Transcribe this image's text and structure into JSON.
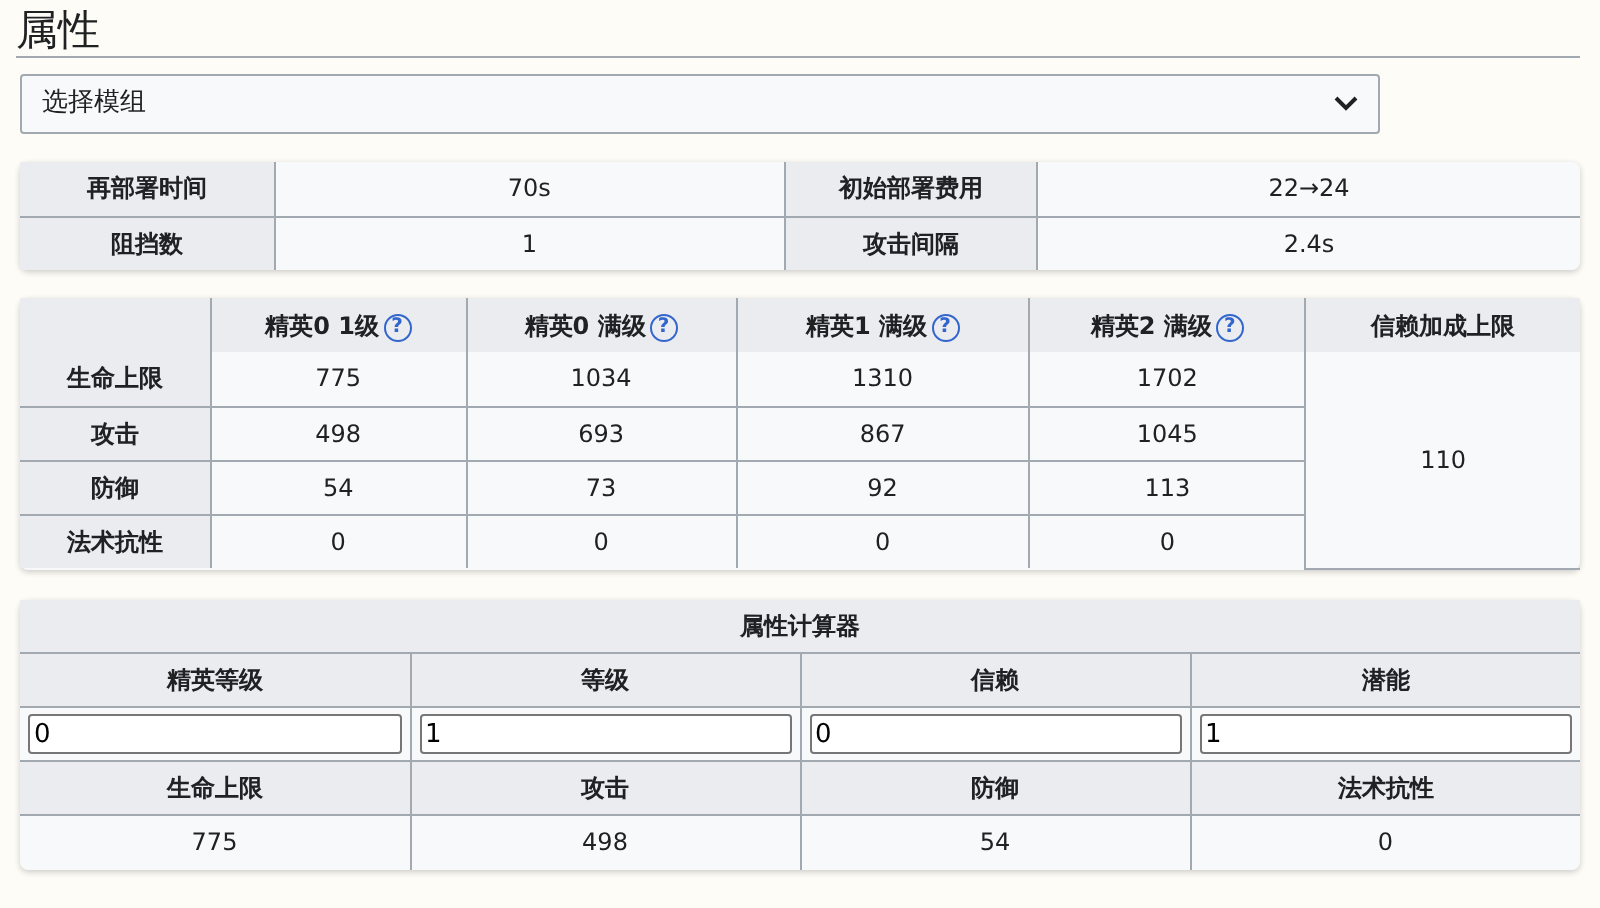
{
  "heading": "属性",
  "module_select": {
    "value": "选择模组"
  },
  "deploy_table": {
    "rows": [
      {
        "cells": [
          {
            "label": "再部署时间",
            "value": "70s"
          },
          {
            "label": "初始部署费用",
            "value": "22→24"
          }
        ]
      },
      {
        "cells": [
          {
            "label": "阻挡数",
            "value": "1"
          },
          {
            "label": "攻击间隔",
            "value": "2.4s"
          }
        ]
      }
    ]
  },
  "stats_table": {
    "columns": [
      {
        "label": "精英0 1级",
        "help": "?"
      },
      {
        "label": "精英0 满级",
        "help": "?"
      },
      {
        "label": "精英1 满级",
        "help": "?"
      },
      {
        "label": "精英2 满级",
        "help": "?"
      },
      {
        "label": "信赖加成上限"
      }
    ],
    "rows": [
      {
        "label": "生命上限",
        "values": [
          "775",
          "1034",
          "1310",
          "1702"
        ]
      },
      {
        "label": "攻击",
        "values": [
          "498",
          "693",
          "867",
          "1045"
        ]
      },
      {
        "label": "防御",
        "values": [
          "54",
          "73",
          "92",
          "113"
        ]
      },
      {
        "label": "法术抗性",
        "values": [
          "0",
          "0",
          "0",
          "0"
        ]
      }
    ],
    "trust_bonus": "110"
  },
  "calculator": {
    "title": "属性计算器",
    "inputs": [
      {
        "label": "精英等级",
        "value": "0"
      },
      {
        "label": "等级",
        "value": "1"
      },
      {
        "label": "信赖",
        "value": "0"
      },
      {
        "label": "潜能",
        "value": "1"
      }
    ],
    "results": [
      {
        "label": "生命上限",
        "value": "775"
      },
      {
        "label": "攻击",
        "value": "498"
      },
      {
        "label": "防御",
        "value": "54"
      },
      {
        "label": "法术抗性",
        "value": "0"
      }
    ]
  }
}
